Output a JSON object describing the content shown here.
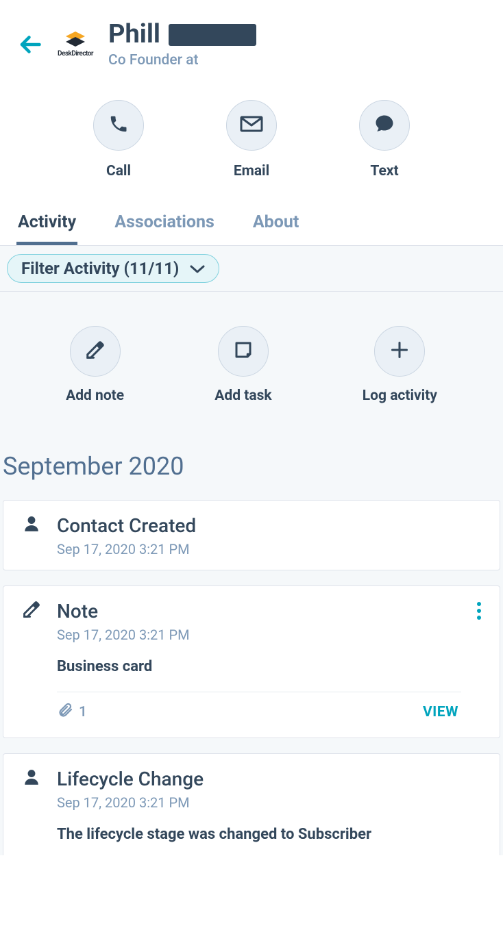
{
  "header": {
    "logo_text": "DeskDirector",
    "contact_name": "Phill",
    "subtitle": "Co Founder at"
  },
  "contact_actions": {
    "call": "Call",
    "email": "Email",
    "text": "Text"
  },
  "tabs": {
    "activity": "Activity",
    "associations": "Associations",
    "about": "About"
  },
  "filter": {
    "label": "Filter Activity (11/11)"
  },
  "quick_actions": {
    "add_note": "Add note",
    "add_task": "Add task",
    "log_activity": "Log activity"
  },
  "timeline": {
    "month": "September 2020",
    "items": [
      {
        "title": "Contact Created",
        "timestamp": "Sep 17, 2020 3:21 PM"
      },
      {
        "title": "Note",
        "timestamp": "Sep 17, 2020 3:21 PM",
        "body": "Business card",
        "attachment_count": "1",
        "view_label": "VIEW"
      },
      {
        "title": "Lifecycle Change",
        "timestamp": "Sep 17, 2020 3:21 PM",
        "body": "The lifecycle stage was changed to Subscriber"
      }
    ]
  }
}
